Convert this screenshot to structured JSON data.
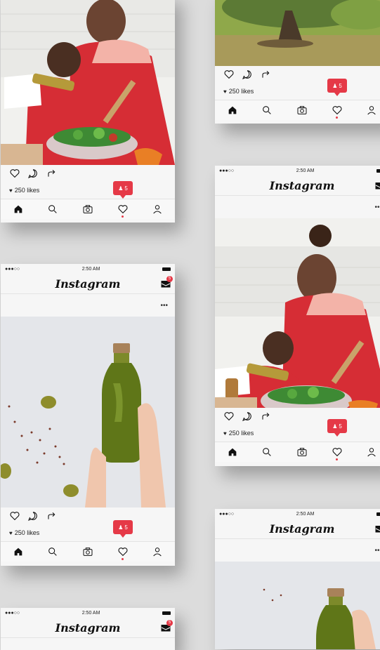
{
  "app": {
    "brand": "Instagram",
    "status_time": "2:50 AM",
    "signal": "●●●○○"
  },
  "post": {
    "likes": "250 likes",
    "notif_count": "5",
    "inbox_badge": "5"
  },
  "colors": {
    "accent": "#e53947",
    "bg": "#dcdcdc"
  }
}
